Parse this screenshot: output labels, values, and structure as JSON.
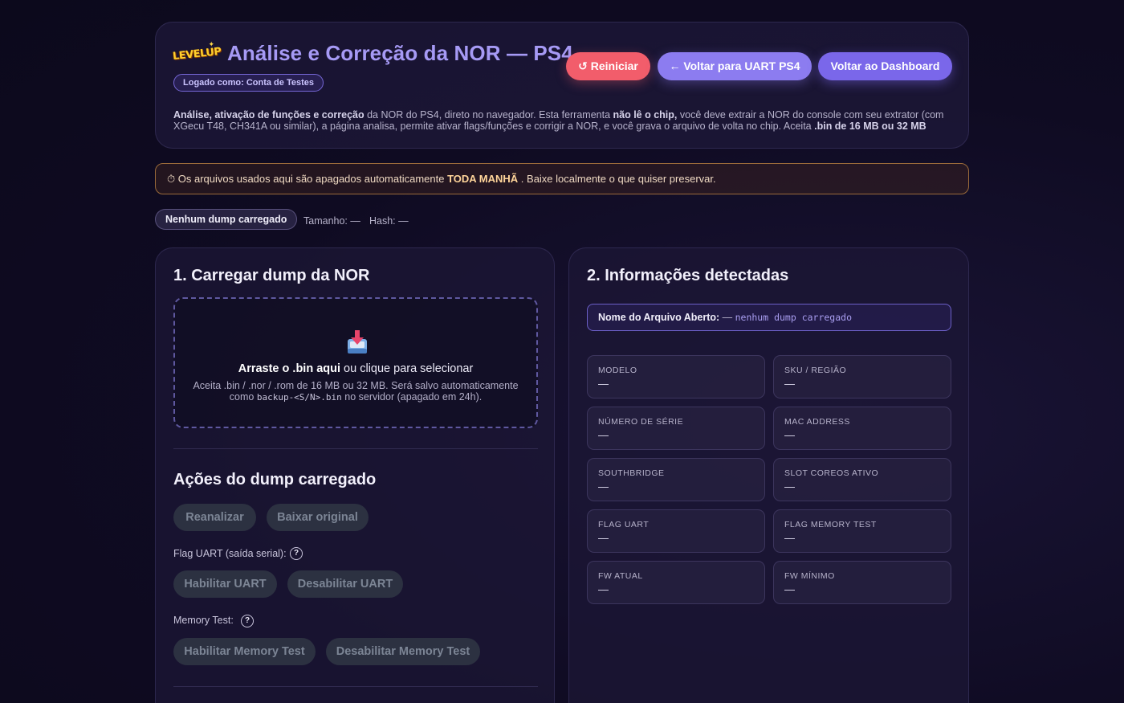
{
  "header": {
    "logo_text": "LEVELUP",
    "title": "Análise e Correção da NOR — PS4",
    "logged_in": "Logado como: Conta de Testes",
    "buttons": {
      "restart": "↺ Reiniciar",
      "back_uart": "← Voltar para UART PS4",
      "dashboard": "Voltar ao Dashboard"
    },
    "intro": {
      "p1": "Análise, ativação de funções e correção",
      "p2": " da NOR do PS4, direto no navegador. Esta ferramenta ",
      "p3": "não lê o chip,",
      "p4": " você deve extrair a NOR do console com seu extrator (com XGecu T48, CH341A ou similar), a página analisa, permite ativar flags/funções e corrigir a NOR, e você grava o arquivo de volta no chip. Aceita ",
      "p5": ".bin de 16 MB ou 32 MB"
    }
  },
  "warning": {
    "icon": "⏱",
    "text_before": " Os arquivos usados aqui são apagados automaticamente ",
    "highlight": "TODA MANHÃ",
    "text_after": " . Baixe localmente o que quiser preservar."
  },
  "status": {
    "pill": "Nenhum dump carregado",
    "size": "Tamanho: —",
    "hash": "Hash: —"
  },
  "upload_panel": {
    "title": "1. Carregar dump da NOR",
    "drop_bold": "Arraste o .bin aqui",
    "drop_rest": " ou clique para selecionar",
    "hint_before": "Aceita .bin / .nor / .rom de 16 MB ou 32 MB. Será salvo automaticamente",
    "hint_como": "como ",
    "hint_mono": "backup-<S/N>.bin",
    "hint_after": " no servidor (apagado em 24h).",
    "actions_title": "Ações do dump carregado",
    "reanalyze": "Reanalizar",
    "download_original": "Baixar original",
    "uart_label": "Flag UART (saída serial):",
    "enable_uart": "Habilitar UART",
    "disable_uart": "Desabilitar UART",
    "memtest_label": "Memory Test:",
    "enable_memtest": "Habilitar Memory Test",
    "disable_memtest": "Desabilitar Memory Test",
    "help_glyph": "?"
  },
  "info_panel": {
    "title": "2. Informações detectadas",
    "filename_label": "Nome do Arquivo Aberto:",
    "filename_dash": " — ",
    "filename_value": "nenhum dump carregado",
    "fields": [
      {
        "label": "MODELO",
        "value": "—"
      },
      {
        "label": "SKU / REGIÃO",
        "value": "—"
      },
      {
        "label": "NÚMERO DE SÉRIE",
        "value": "—"
      },
      {
        "label": "MAC ADDRESS",
        "value": "—"
      },
      {
        "label": "SOUTHBRIDGE",
        "value": "—"
      },
      {
        "label": "SLOT COREOS ATIVO",
        "value": "—"
      },
      {
        "label": "FLAG UART",
        "value": "—"
      },
      {
        "label": "FLAG MEMORY TEST",
        "value": "—"
      },
      {
        "label": "FW ATUAL",
        "value": "—"
      },
      {
        "label": "FW MÍNIMO",
        "value": "—"
      }
    ]
  },
  "colors": {
    "accent": "#7a67ea",
    "title": "#a69af5",
    "danger": "#f25d6b",
    "warning_border": "#9a6a3a"
  },
  "icons": {
    "upload": "download-tray-icon",
    "timer": "stopwatch-icon"
  }
}
